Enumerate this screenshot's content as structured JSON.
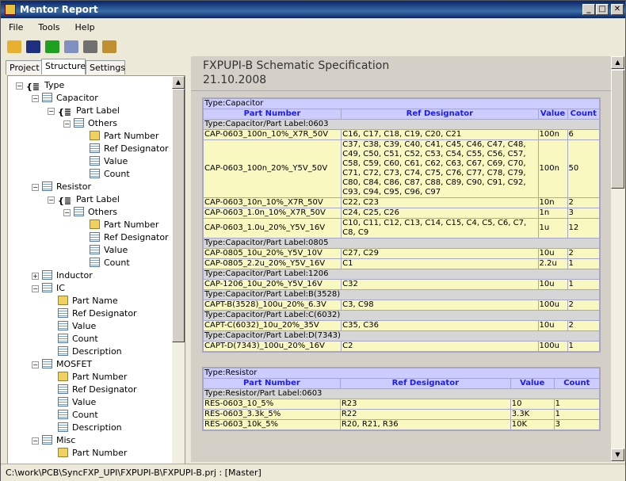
{
  "window": {
    "title": "Mentor Report",
    "min": "_",
    "max": "□",
    "close": "✕"
  },
  "menu": [
    "File",
    "Tools",
    "Help"
  ],
  "toolbar": [
    {
      "icon": "open-icon",
      "color": "#e8b030"
    },
    {
      "icon": "save-icon",
      "color": "#203080"
    },
    {
      "icon": "refresh-icon",
      "color": "#20a020"
    },
    {
      "icon": "preview-icon",
      "color": "#8090c0"
    },
    {
      "icon": "print-icon",
      "color": "#707070"
    },
    {
      "icon": "settings-icon",
      "color": "#c09030"
    }
  ],
  "tabs": [
    "Project",
    "Structure",
    "Settings"
  ],
  "tree": [
    {
      "d": 0,
      "pm": "−",
      "ic": "brace",
      "label": "Type"
    },
    {
      "d": 1,
      "pm": "−",
      "ic": "tbl",
      "label": "Capacitor"
    },
    {
      "d": 2,
      "pm": "−",
      "ic": "brace",
      "label": "Part Label"
    },
    {
      "d": 3,
      "pm": "−",
      "ic": "tbl",
      "label": "Others"
    },
    {
      "d": 4,
      "ic": "key",
      "label": "Part Number"
    },
    {
      "d": 4,
      "ic": "tbl",
      "label": "Ref Designator"
    },
    {
      "d": 4,
      "ic": "tbl",
      "label": "Value"
    },
    {
      "d": 4,
      "ic": "tbl",
      "label": "Count"
    },
    {
      "d": 1,
      "pm": "−",
      "ic": "tbl",
      "label": "Resistor"
    },
    {
      "d": 2,
      "pm": "−",
      "ic": "brace",
      "label": "Part Label"
    },
    {
      "d": 3,
      "pm": "−",
      "ic": "tbl",
      "label": "Others"
    },
    {
      "d": 4,
      "ic": "key",
      "label": "Part Number"
    },
    {
      "d": 4,
      "ic": "tbl",
      "label": "Ref Designator"
    },
    {
      "d": 4,
      "ic": "tbl",
      "label": "Value"
    },
    {
      "d": 4,
      "ic": "tbl",
      "label": "Count"
    },
    {
      "d": 1,
      "pm": "+",
      "ic": "tbl",
      "label": "Inductor"
    },
    {
      "d": 1,
      "pm": "−",
      "ic": "tbl",
      "label": "IC"
    },
    {
      "d": 2,
      "ic": "key",
      "label": "Part Name"
    },
    {
      "d": 2,
      "ic": "tbl",
      "label": "Ref Designator"
    },
    {
      "d": 2,
      "ic": "tbl",
      "label": "Value"
    },
    {
      "d": 2,
      "ic": "tbl",
      "label": "Count"
    },
    {
      "d": 2,
      "ic": "tbl",
      "label": "Description"
    },
    {
      "d": 1,
      "pm": "−",
      "ic": "tbl",
      "label": "MOSFET"
    },
    {
      "d": 2,
      "ic": "key",
      "label": "Part Number"
    },
    {
      "d": 2,
      "ic": "tbl",
      "label": "Ref Designator"
    },
    {
      "d": 2,
      "ic": "tbl",
      "label": "Value"
    },
    {
      "d": 2,
      "ic": "tbl",
      "label": "Count"
    },
    {
      "d": 2,
      "ic": "tbl",
      "label": "Description"
    },
    {
      "d": 1,
      "pm": "−",
      "ic": "tbl",
      "label": "Misc"
    },
    {
      "d": 2,
      "ic": "key",
      "label": "Part Number"
    }
  ],
  "report": {
    "title": "FXPUPI-B Schematic Specification",
    "date": "21.10.2008",
    "sections": [
      {
        "title": "Type:Capacitor",
        "cols": [
          "Part Number",
          "Ref Designator",
          "Value",
          "Count"
        ],
        "widths": [
          175,
          250,
          37,
          41
        ],
        "groups": [
          {
            "label": "Type:Capacitor/Part Label:0603",
            "rows": [
              [
                "CAP-0603_100n_10%_X7R_50V",
                "C16, C17, C18, C19, C20, C21",
                "100n",
                "6"
              ],
              [
                "CAP-0603_100n_20%_Y5V_50V",
                "C37, C38, C39, C40, C41, C45, C46, C47, C48, C49, C50, C51, C52, C53, C54, C55, C56, C57, C58, C59, C60, C61, C62, C63, C67, C69, C70, C71, C72, C73, C74, C75, C76, C77, C78, C79, C80, C84, C86, C87, C88, C89, C90, C91, C92, C93, C94, C95, C96, C97",
                "100n",
                "50"
              ],
              [
                "CAP-0603_10n_10%_X7R_50V",
                "C22, C23",
                "10n",
                "2"
              ],
              [
                "CAP-0603_1.0n_10%_X7R_50V",
                "C24, C25, C26",
                "1n",
                "3"
              ],
              [
                "CAP-0603_1.0u_20%_Y5V_16V",
                "C10, C11, C12, C13, C14, C15, C4, C5, C6, C7, C8, C9",
                "1u",
                "12"
              ]
            ]
          },
          {
            "label": "Type:Capacitor/Part Label:0805",
            "rows": [
              [
                "CAP-0805_10u_20%_Y5V_10V",
                "C27, C29",
                "10u",
                "2"
              ],
              [
                "CAP-0805_2.2u_20%_Y5V_16V",
                "C1",
                "2.2u",
                "1"
              ]
            ]
          },
          {
            "label": "Type:Capacitor/Part Label:1206",
            "rows": [
              [
                "CAP-1206_10u_20%_Y5V_16V",
                "C32",
                "10u",
                "1"
              ]
            ]
          },
          {
            "label": "Type:Capacitor/Part Label:B(3528)",
            "rows": [
              [
                "CAPT-B(3528)_100u_20%_6.3V",
                "C3, C98",
                "100u",
                "2"
              ]
            ]
          },
          {
            "label": "Type:Capacitor/Part Label:C(6032)",
            "rows": [
              [
                "CAPT-C(6032)_10u_20%_35V",
                "C35, C36",
                "10u",
                "2"
              ]
            ]
          },
          {
            "label": "Type:Capacitor/Part Label:D(7343)",
            "rows": [
              [
                "CAPT-D(7343)_100u_20%_16V",
                "C2",
                "100u",
                "1"
              ]
            ]
          }
        ]
      },
      {
        "title": "Type:Resistor",
        "cols": [
          "Part Number",
          "Ref Designator",
          "Value",
          "Count"
        ],
        "widths": [
          174,
          216,
          55,
          58
        ],
        "groups": [
          {
            "label": "Type:Resistor/Part Label:0603",
            "rows": [
              [
                "RES-0603_10_5%",
                "R23",
                "10",
                "1"
              ],
              [
                "RES-0603_3.3k_5%",
                "R22",
                "3.3K",
                "1"
              ],
              [
                "RES-0603_10k_5%",
                "R20, R21, R36",
                "10K",
                "3"
              ]
            ]
          }
        ]
      }
    ]
  },
  "status": "C:\\work\\PCB\\SyncFXP_UPI\\FXPUPI-B\\FXPUPI-B.prj : [Master]"
}
